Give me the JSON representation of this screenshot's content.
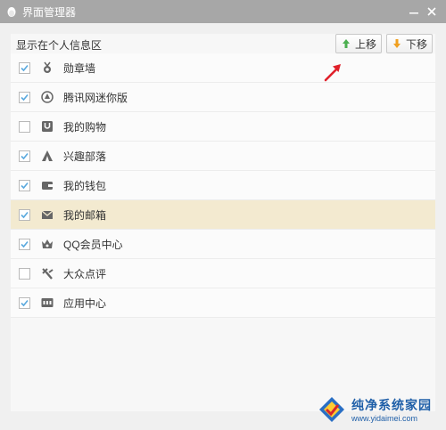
{
  "window": {
    "title": "界面管理器"
  },
  "toolbar": {
    "section_label": "显示在个人信息区",
    "move_up_label": "上移",
    "move_down_label": "下移"
  },
  "items": [
    {
      "label": "勋章墙",
      "icon": "medal-icon",
      "checked": true,
      "selected": false
    },
    {
      "label": "腾讯网迷你版",
      "icon": "tencent-news-icon",
      "checked": true,
      "selected": false
    },
    {
      "label": "我的购物",
      "icon": "shopping-bag-icon",
      "checked": false,
      "selected": false
    },
    {
      "label": "兴趣部落",
      "icon": "tribe-tent-icon",
      "checked": true,
      "selected": false
    },
    {
      "label": "我的钱包",
      "icon": "wallet-icon",
      "checked": true,
      "selected": false
    },
    {
      "label": "我的邮箱",
      "icon": "mail-icon",
      "checked": true,
      "selected": true
    },
    {
      "label": "QQ会员中心",
      "icon": "vip-crown-icon",
      "checked": true,
      "selected": false
    },
    {
      "label": "大众点评",
      "icon": "dianping-icon",
      "checked": false,
      "selected": false
    },
    {
      "label": "应用中心",
      "icon": "app-center-icon",
      "checked": true,
      "selected": false
    }
  ],
  "watermark": {
    "title": "纯净系统家园",
    "url": "www.yidaimei.com"
  },
  "colors": {
    "titlebar": "#a7a7a7",
    "selected_row": "#f3ead0",
    "check": "#5aa9de",
    "arrow_up": "#4caf50",
    "arrow_down": "#f0a020",
    "pointer": "#e0202a"
  }
}
